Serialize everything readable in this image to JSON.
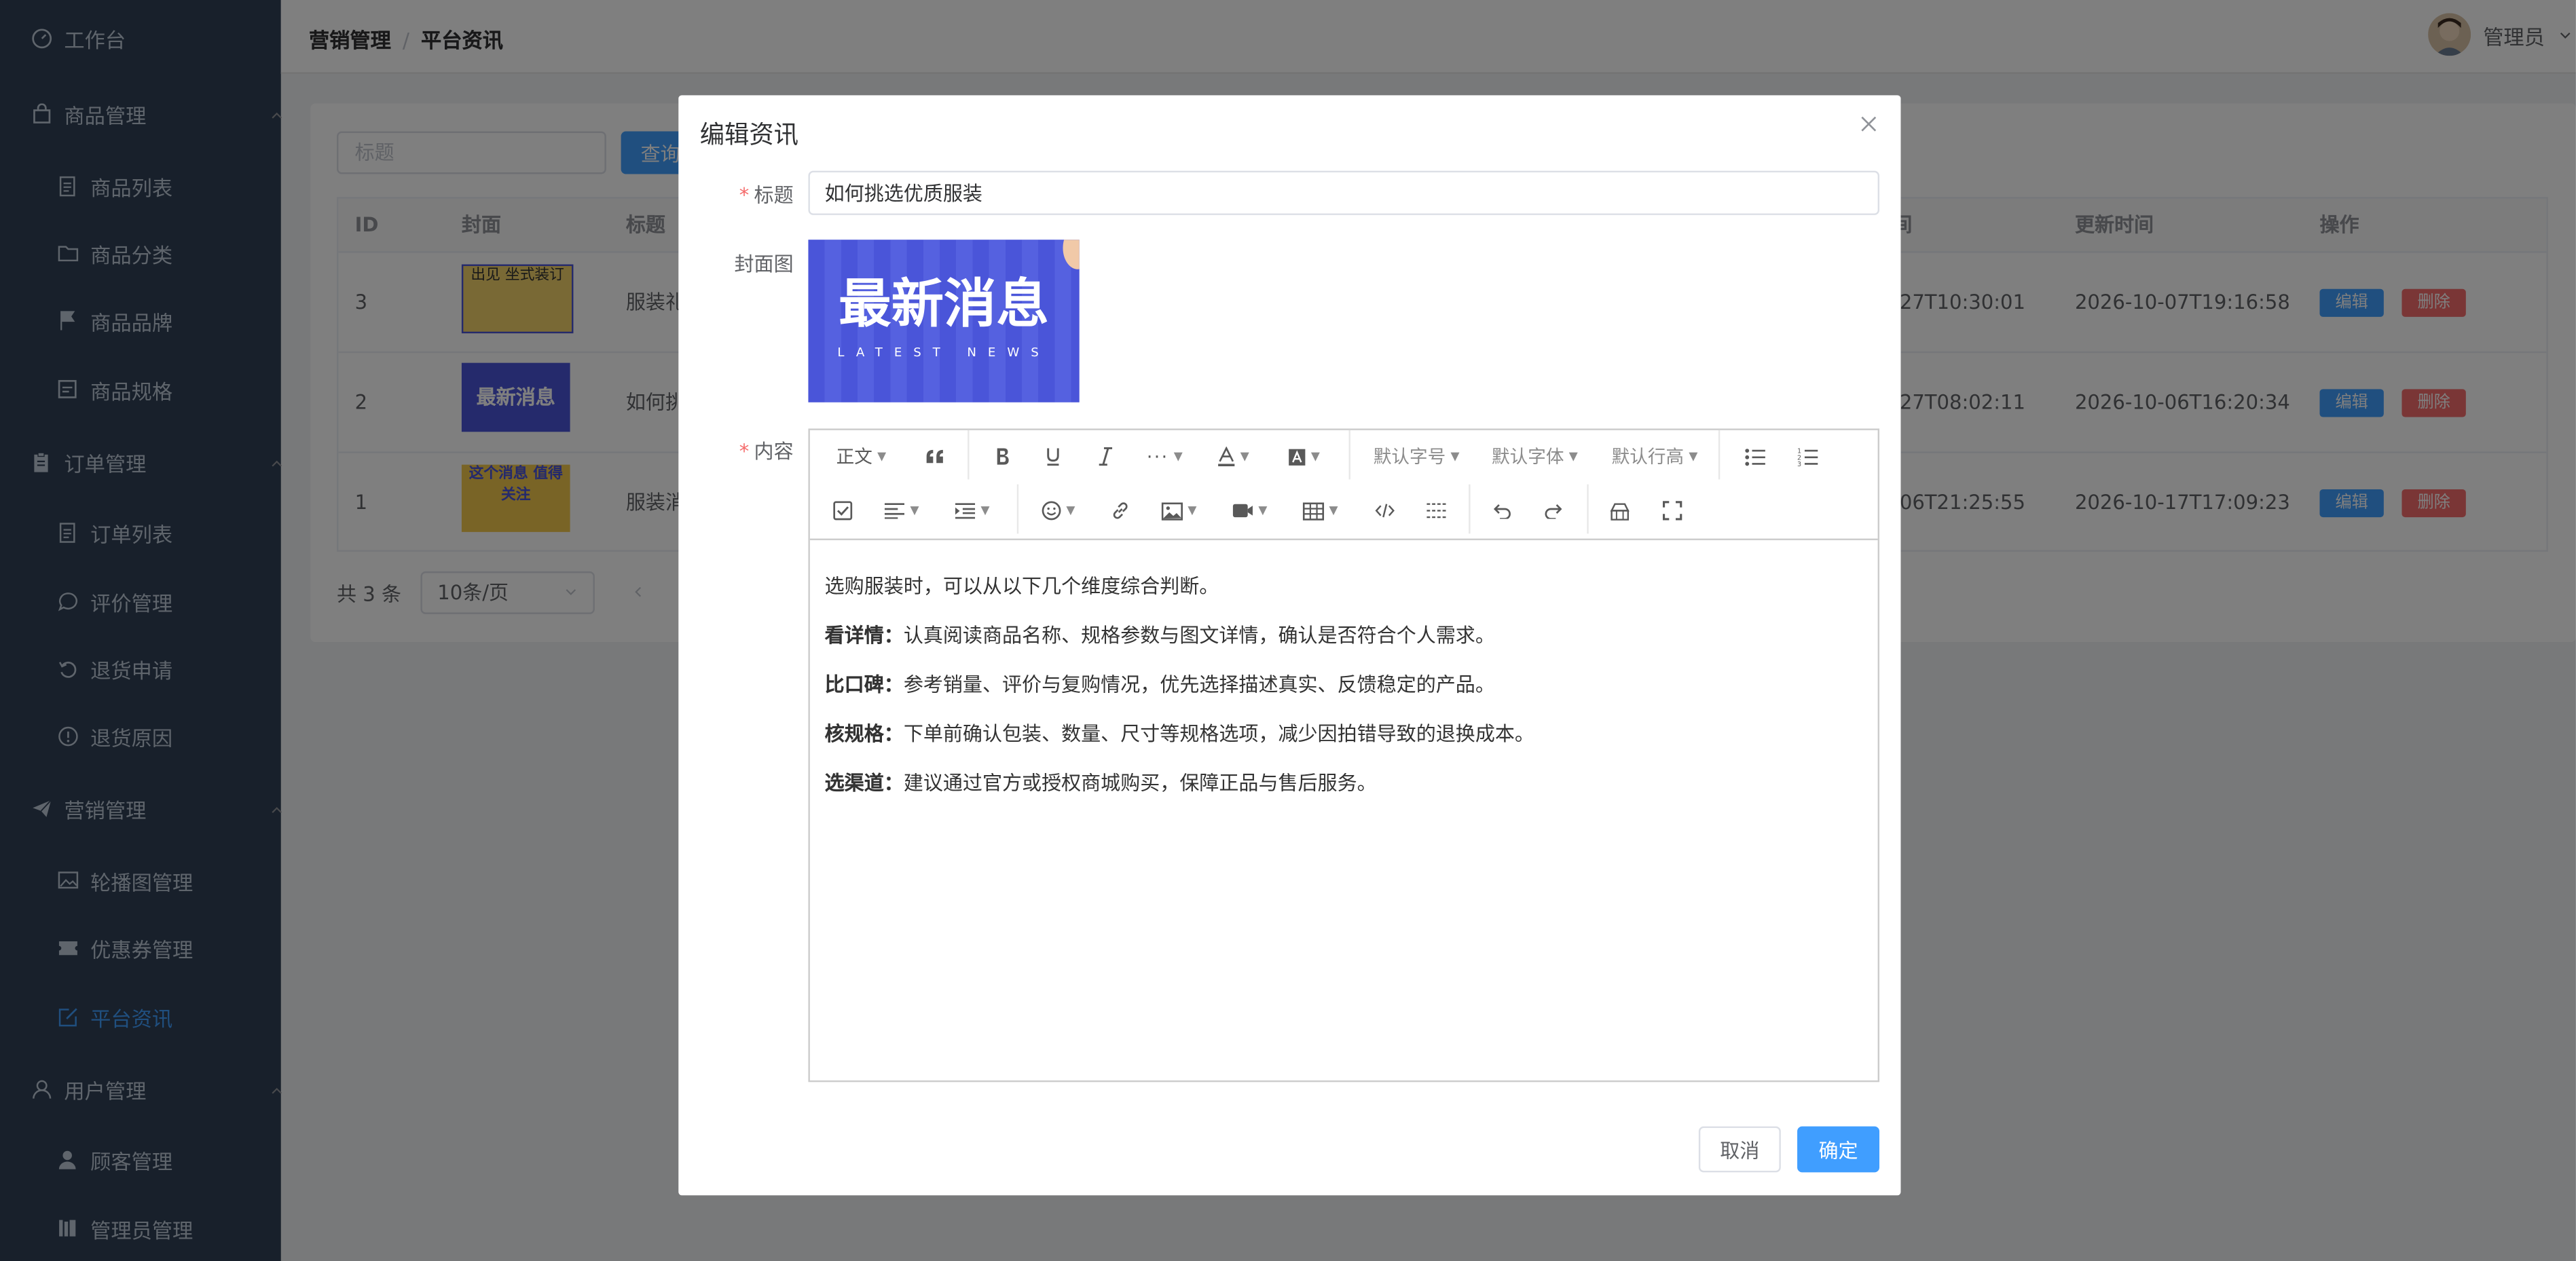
{
  "sidebar": {
    "workbench": "工作台",
    "groups": [
      {
        "label": "商品管理",
        "items": [
          "商品列表",
          "商品分类",
          "商品品牌",
          "商品规格"
        ]
      },
      {
        "label": "订单管理",
        "items": [
          "订单列表",
          "评价管理",
          "退货申请",
          "退货原因"
        ]
      },
      {
        "label": "营销管理",
        "items": [
          "轮播图管理",
          "优惠券管理",
          "平台资讯"
        ]
      },
      {
        "label": "用户管理",
        "items": [
          "顾客管理",
          "管理员管理"
        ]
      }
    ],
    "active_item": "平台资讯"
  },
  "header": {
    "breadcrumb": [
      "营销管理",
      "平台资讯"
    ],
    "user_name": "管理员"
  },
  "search": {
    "placeholder": "标题",
    "query_label": "查询"
  },
  "table": {
    "columns": [
      "ID",
      "封面",
      "标题",
      "更新时间",
      "操作"
    ],
    "rows": [
      {
        "id": "3",
        "title": "服装礼",
        "created": "-27T10:30:01",
        "updated": "2026-10-07T19:16:58"
      },
      {
        "id": "2",
        "title": "如何挑",
        "created": "-27T08:02:11",
        "updated": "2026-10-06T16:20:34"
      },
      {
        "id": "1",
        "title": "服装消",
        "created": "-06T21:25:55",
        "updated": "2026-10-17T17:09:23"
      }
    ],
    "edit_label": "编辑",
    "delete_label": "删除",
    "thumbs": [
      "出见 坐式装订",
      "最新消息",
      "这个消息 值得关注"
    ]
  },
  "pagination": {
    "total": "共 3 条",
    "page_size": "10条/页"
  },
  "dialog": {
    "title": "编辑资讯",
    "title_label": "标题",
    "title_value": "如何挑选优质服装",
    "cover_label": "封面图",
    "cover_heading": "最新消息",
    "cover_sub": "LATEST NEWS",
    "content_label": "内容",
    "toolbar": {
      "paragraph": "正文",
      "font_size": "默认字号",
      "font_family": "默认字体",
      "line_height": "默认行高"
    },
    "content": {
      "intro": "选购服装时，可以从以下几个维度综合判断。",
      "points": [
        {
          "title": "看详情：",
          "text": "认真阅读商品名称、规格参数与图文详情，确认是否符合个人需求。"
        },
        {
          "title": "比口碑：",
          "text": "参考销量、评价与复购情况，优先选择描述真实、反馈稳定的产品。"
        },
        {
          "title": "核规格：",
          "text": "下单前确认包装、数量、尺寸等规格选项，减少因拍错导致的退换成本。"
        },
        {
          "title": "选渠道：",
          "text": "建议通过官方或授权商城购买，保障正品与售后服务。"
        }
      ]
    },
    "cancel_label": "取消",
    "confirm_label": "确定"
  },
  "colors": {
    "sidebar_bg": "#304156",
    "primary": "#409eff",
    "danger": "#f56c6c",
    "cover_bg": "#4a55d9"
  }
}
